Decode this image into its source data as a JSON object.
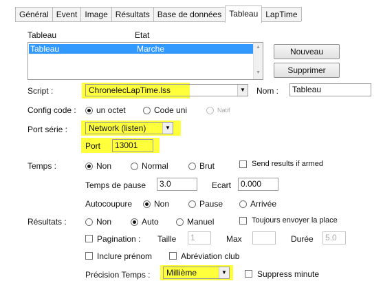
{
  "tabs": [
    "Général",
    "Event",
    "Image",
    "Résultats",
    "Base de données",
    "Tableau",
    "LapTime"
  ],
  "active_tab": "Tableau",
  "list": {
    "col_tableau": "Tableau",
    "col_etat": "Etat",
    "rows": [
      {
        "tableau": "Tableau",
        "etat": "Marche"
      }
    ]
  },
  "buttons": {
    "nouveau": "Nouveau",
    "supprimer": "Supprimer"
  },
  "script": {
    "label": "Script :",
    "value": "ChronelecLapTime.lss"
  },
  "nom": {
    "label": "Nom :",
    "value": "Tableau"
  },
  "config_code": {
    "label": "Config code :",
    "options": [
      "un octet",
      "Code uni",
      "Natif"
    ],
    "selected": "un octet"
  },
  "port_serie": {
    "label": "Port série :",
    "value": "Network (listen)"
  },
  "port": {
    "label": "Port",
    "value": "13001"
  },
  "temps": {
    "label": "Temps :",
    "options": [
      "Non",
      "Normal",
      "Brut"
    ],
    "selected": "Non",
    "send_results_label": "Send results if armed",
    "send_results_checked": false
  },
  "pause": {
    "label": "Temps de pause",
    "value": "3.0",
    "ecart_label": "Ecart",
    "ecart_value": "0.000"
  },
  "autocoupure": {
    "label": "Autocoupure",
    "options": [
      "Non",
      "Pause",
      "Arrivée"
    ],
    "selected": "Non"
  },
  "resultats": {
    "label": "Résultats :",
    "options": [
      "Non",
      "Auto",
      "Manuel"
    ],
    "selected": "Auto",
    "toujours_label": "Toujours envoyer la place",
    "toujours_checked": false
  },
  "pagination": {
    "label": "Pagination :",
    "checked": false,
    "taille_label": "Taille",
    "taille_value": "1",
    "max_label": "Max",
    "max_value": "",
    "duree_label": "Durée",
    "duree_value": "5.0"
  },
  "prenom": {
    "label": "Inclure prénom",
    "checked": false
  },
  "abreviation": {
    "label": "Abréviation club",
    "checked": false
  },
  "precision": {
    "label": "Précision Temps :",
    "value": "Millième"
  },
  "suppress": {
    "label": "Suppress minute",
    "checked": false
  },
  "colors": {
    "highlight": "#ffff3c",
    "selection": "#3399ff"
  }
}
